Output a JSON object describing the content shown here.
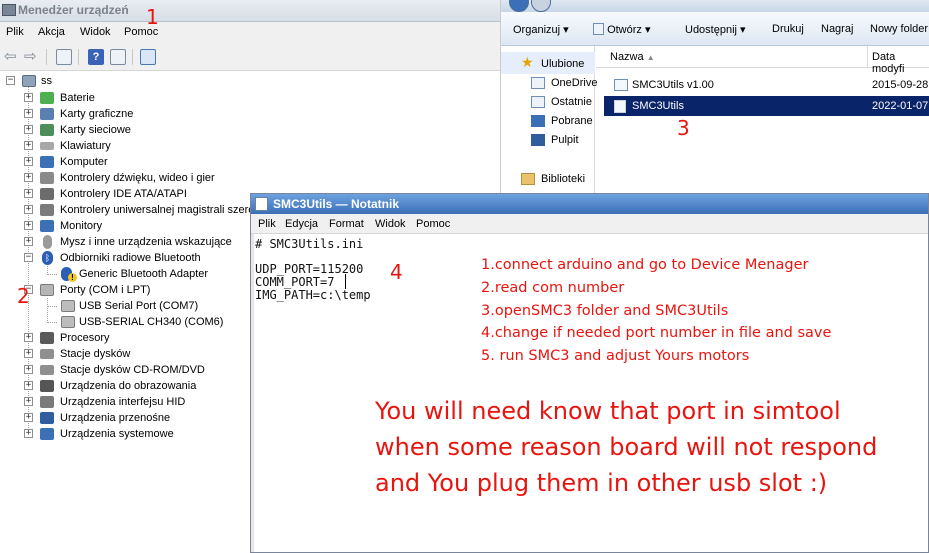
{
  "device_manager": {
    "title": "Menedżer urządzeń",
    "menu": [
      "Plik",
      "Akcja",
      "Widok",
      "Pomoc"
    ],
    "tree_root": "ss",
    "nodes": [
      "Baterie",
      "Karty graficzne",
      "Karty sieciowe",
      "Klawiatury",
      "Komputer",
      "Kontrolery dźwięku, wideo i gier",
      "Kontrolery IDE ATA/ATAPI",
      "Kontrolery uniwersalnej magistrali szere",
      "Monitory",
      "Mysz i inne urządzenia wskazujące",
      "Odbiorniki radiowe Bluetooth",
      "Generic Bluetooth Adapter",
      "Porty (COM i LPT)",
      "USB Serial Port (COM7)",
      "USB-SERIAL CH340 (COM6)",
      "Procesory",
      "Stacje dysków",
      "Stacje dysków CD-ROM/DVD",
      "Urządzenia do obrazowania",
      "Urządzenia interfejsu HID",
      "Urządzenia przenośne",
      "Urządzenia systemowe"
    ]
  },
  "explorer": {
    "commands": [
      "Organizuj",
      "Otwórz",
      "Udostępnij",
      "Drukuj",
      "Nagraj",
      "Nowy folder"
    ],
    "nav": {
      "favorites": "Ulubione",
      "items": [
        "OneDrive",
        "Ostatnie",
        "Pobrane",
        "Pulpit"
      ],
      "libraries": "Biblioteki"
    },
    "columns": {
      "name": "Nazwa",
      "date": "Data modyfi"
    },
    "files": [
      {
        "name": "SMC3Utils v1.00",
        "date": "2015-09-28",
        "selected": false
      },
      {
        "name": "SMC3Utils",
        "date": "2022-01-07",
        "selected": true
      }
    ]
  },
  "notepad": {
    "title": "SMC3Utils — Notatnik",
    "menu": [
      "Plik",
      "Edycja",
      "Format",
      "Widok",
      "Pomoc"
    ],
    "lines": [
      "# SMC3Utils.ini",
      "",
      "UDP_PORT=115200",
      "COMM_PORT=7",
      "IMG_PATH=c:\\temp"
    ]
  },
  "annotations": {
    "markers": [
      "1",
      "2",
      "3",
      "4"
    ],
    "steps": [
      "1.connect arduino and go to Device Menager",
      "2.read com number",
      "3.openSMC3 folder and SMC3Utils",
      "4.change if needed port number in file and save",
      "5. run SMC3 and adjust Yours motors"
    ],
    "note": [
      "You will need know that port in simtool",
      "when some reason board will not respond",
      "and You plug them in other usb slot :)"
    ],
    "color": "#e8150f"
  }
}
